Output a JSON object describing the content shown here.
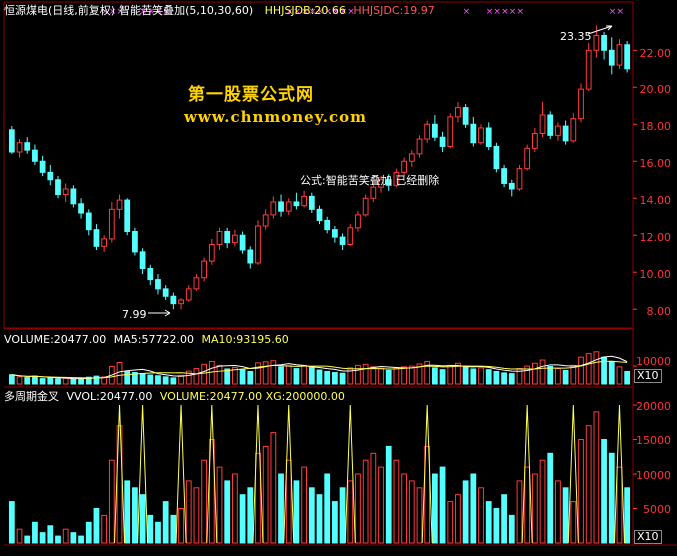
{
  "title_stock": "恒源煤电(日线,前复权)",
  "title_indicator": "智能苦笑叠加(5,10,30,60)",
  "hhjsjdb": "HHJSJDB:20.66",
  "hhjsjdc": "HHJSJDC:19.97",
  "watermark_cn": "第一股票公式网",
  "watermark_url": "www.chnmoney.com",
  "note": "公式:智能苦笑叠加 已经删除",
  "price_high_label": "23.35",
  "price_low_label": "7.99",
  "price_axis": [
    "22.00",
    "20.00",
    "18.00",
    "16.00",
    "14.00",
    "12.00",
    "10.00",
    "8.00"
  ],
  "vol_header": {
    "volume": "VOLUME:20477.00",
    "ma5": "MA5:57722.00",
    "ma10": "MA10:93195.60"
  },
  "vol_axis": [
    "10000"
  ],
  "vol_unit": "X10",
  "ind_header": {
    "name": "多周期金叉",
    "vvol": "VVOL:20477.00",
    "volume": "VOLUME:20477.00",
    "xg": "XG:200000.00"
  },
  "ind_axis": [
    "20000",
    "15000",
    "10000",
    "5000"
  ],
  "ind_unit": "X10",
  "colors": {
    "up": "#ff3b3b",
    "down": "#54ffff",
    "grid": "#8b0000",
    "yellow": "#ffff54",
    "magenta": "#ff54ff"
  },
  "chart_data": {
    "type": "candlestick",
    "ylim": [
      7.2,
      23.8
    ],
    "candles": [
      [
        17.7,
        17.9,
        16.4,
        16.5
      ],
      [
        16.5,
        17.2,
        16.2,
        17.0
      ],
      [
        17.0,
        17.3,
        16.4,
        16.6
      ],
      [
        16.6,
        16.9,
        15.8,
        16.0
      ],
      [
        16.0,
        16.3,
        15.2,
        15.4
      ],
      [
        15.4,
        15.8,
        14.7,
        15.0
      ],
      [
        15.0,
        15.2,
        14.0,
        14.2
      ],
      [
        14.2,
        14.8,
        13.8,
        14.5
      ],
      [
        14.5,
        14.7,
        13.5,
        13.7
      ],
      [
        13.7,
        14.0,
        12.9,
        13.2
      ],
      [
        13.2,
        13.4,
        12.0,
        12.3
      ],
      [
        12.3,
        12.6,
        11.2,
        11.4
      ],
      [
        11.4,
        12.0,
        11.1,
        11.8
      ],
      [
        11.8,
        13.8,
        11.6,
        13.4
      ],
      [
        13.4,
        14.2,
        12.9,
        13.9
      ],
      [
        13.9,
        14.0,
        12.0,
        12.2
      ],
      [
        12.2,
        12.4,
        10.9,
        11.1
      ],
      [
        11.1,
        11.3,
        9.9,
        10.2
      ],
      [
        10.2,
        10.4,
        9.3,
        9.6
      ],
      [
        9.6,
        9.9,
        8.8,
        9.1
      ],
      [
        9.1,
        9.3,
        8.5,
        8.7
      ],
      [
        8.7,
        8.9,
        8.0,
        8.3
      ],
      [
        8.3,
        8.6,
        7.99,
        8.5
      ],
      [
        8.5,
        9.3,
        8.4,
        9.1
      ],
      [
        9.1,
        9.9,
        9.0,
        9.7
      ],
      [
        9.7,
        10.8,
        9.5,
        10.6
      ],
      [
        10.6,
        11.8,
        10.4,
        11.5
      ],
      [
        11.5,
        12.4,
        11.2,
        12.2
      ],
      [
        12.2,
        12.4,
        11.3,
        11.6
      ],
      [
        11.6,
        12.3,
        11.4,
        12.0
      ],
      [
        12.0,
        12.2,
        11.0,
        11.2
      ],
      [
        11.2,
        11.4,
        10.2,
        10.5
      ],
      [
        10.5,
        12.8,
        10.4,
        12.5
      ],
      [
        12.5,
        13.4,
        12.3,
        13.1
      ],
      [
        13.1,
        14.1,
        12.9,
        13.8
      ],
      [
        13.8,
        14.2,
        13.0,
        13.3
      ],
      [
        13.3,
        14.0,
        13.1,
        13.8
      ],
      [
        13.8,
        14.3,
        13.4,
        13.6
      ],
      [
        13.6,
        14.4,
        13.5,
        14.1
      ],
      [
        14.1,
        14.3,
        13.2,
        13.4
      ],
      [
        13.4,
        13.6,
        12.6,
        12.8
      ],
      [
        12.8,
        13.0,
        12.1,
        12.3
      ],
      [
        12.3,
        12.5,
        11.6,
        11.9
      ],
      [
        11.9,
        12.1,
        11.2,
        11.5
      ],
      [
        11.5,
        12.6,
        11.4,
        12.4
      ],
      [
        12.4,
        13.3,
        12.2,
        13.1
      ],
      [
        13.1,
        14.2,
        13.0,
        14.0
      ],
      [
        14.0,
        14.8,
        13.8,
        14.6
      ],
      [
        14.6,
        15.2,
        14.3,
        15.0
      ],
      [
        15.0,
        15.3,
        14.4,
        14.7
      ],
      [
        14.7,
        15.6,
        14.6,
        15.4
      ],
      [
        15.4,
        16.2,
        15.2,
        16.0
      ],
      [
        16.0,
        16.6,
        15.7,
        16.4
      ],
      [
        16.4,
        17.4,
        16.2,
        17.2
      ],
      [
        17.2,
        18.2,
        17.0,
        18.0
      ],
      [
        18.0,
        18.5,
        17.1,
        17.3
      ],
      [
        17.3,
        17.6,
        16.5,
        16.8
      ],
      [
        16.8,
        18.6,
        16.7,
        18.4
      ],
      [
        18.4,
        19.2,
        18.1,
        18.9
      ],
      [
        18.9,
        19.1,
        17.8,
        18.0
      ],
      [
        18.0,
        18.4,
        16.8,
        17.0
      ],
      [
        17.0,
        18.0,
        16.9,
        17.8
      ],
      [
        17.8,
        18.1,
        16.6,
        16.8
      ],
      [
        16.8,
        17.0,
        15.4,
        15.6
      ],
      [
        15.6,
        15.8,
        14.6,
        14.8
      ],
      [
        14.8,
        15.0,
        14.1,
        14.5
      ],
      [
        14.5,
        15.8,
        14.4,
        15.6
      ],
      [
        15.6,
        16.9,
        15.5,
        16.7
      ],
      [
        16.7,
        17.8,
        16.5,
        17.5
      ],
      [
        17.5,
        19.2,
        17.3,
        18.5
      ],
      [
        18.5,
        18.7,
        17.2,
        17.4
      ],
      [
        17.4,
        18.1,
        17.1,
        17.9
      ],
      [
        17.9,
        18.2,
        16.9,
        17.1
      ],
      [
        17.1,
        18.6,
        17.0,
        18.3
      ],
      [
        18.3,
        20.2,
        18.1,
        19.9
      ],
      [
        19.9,
        22.4,
        19.8,
        22.0
      ],
      [
        22.0,
        23.35,
        21.6,
        22.8
      ],
      [
        22.8,
        23.0,
        21.5,
        22.0
      ],
      [
        22.0,
        22.7,
        20.7,
        21.2
      ],
      [
        21.2,
        22.6,
        21.0,
        22.3
      ],
      [
        22.3,
        22.5,
        20.8,
        21.0
      ]
    ],
    "volume": [
      52,
      40,
      36,
      44,
      30,
      34,
      28,
      32,
      26,
      30,
      38,
      44,
      40,
      98,
      120,
      70,
      64,
      58,
      50,
      46,
      40,
      34,
      48,
      72,
      86,
      110,
      126,
      104,
      84,
      92,
      80,
      70,
      118,
      124,
      130,
      96,
      102,
      86,
      104,
      92,
      78,
      70,
      64,
      60,
      90,
      104,
      110,
      96,
      88,
      76,
      90,
      96,
      100,
      112,
      126,
      90,
      80,
      104,
      116,
      94,
      84,
      90,
      80,
      70,
      62,
      58,
      86,
      100,
      116,
      134,
      98,
      86,
      76,
      104,
      150,
      170,
      180,
      150,
      126,
      96,
      70
    ],
    "indicator": [
      60,
      20,
      10,
      30,
      15,
      25,
      10,
      20,
      15,
      10,
      30,
      50,
      40,
      120,
      170,
      90,
      80,
      70,
      40,
      30,
      60,
      40,
      50,
      90,
      80,
      120,
      150,
      110,
      90,
      100,
      70,
      80,
      130,
      140,
      160,
      100,
      120,
      90,
      110,
      80,
      70,
      100,
      60,
      80,
      90,
      100,
      120,
      130,
      110,
      140,
      120,
      100,
      90,
      80,
      140,
      100,
      110,
      60,
      70,
      90,
      100,
      80,
      60,
      50,
      70,
      40,
      90,
      110,
      100,
      120,
      130,
      90,
      80,
      60,
      150,
      170,
      190,
      150,
      130,
      110,
      80
    ],
    "yellow_spikes": [
      14,
      17,
      22,
      26,
      32,
      36,
      44,
      54,
      67,
      73,
      79
    ]
  }
}
